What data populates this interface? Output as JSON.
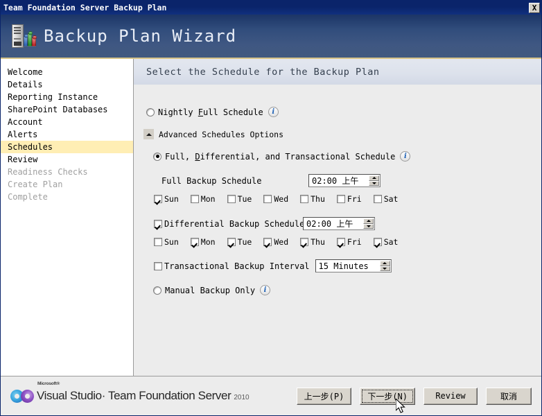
{
  "window": {
    "title": "Team Foundation Server Backup Plan",
    "close_label": "X"
  },
  "banner": {
    "title": "Backup Plan Wizard",
    "icon": "server-backup-icon"
  },
  "sidebar": {
    "items": [
      {
        "label": "Welcome",
        "state": "normal"
      },
      {
        "label": "Details",
        "state": "normal"
      },
      {
        "label": "Reporting Instance",
        "state": "normal"
      },
      {
        "label": "SharePoint Databases",
        "state": "normal"
      },
      {
        "label": "Account",
        "state": "normal"
      },
      {
        "label": "Alerts",
        "state": "normal"
      },
      {
        "label": "Schedules",
        "state": "selected"
      },
      {
        "label": "Review",
        "state": "normal"
      },
      {
        "label": "Readiness Checks",
        "state": "disabled"
      },
      {
        "label": "Create Plan",
        "state": "disabled"
      },
      {
        "label": "Complete",
        "state": "disabled"
      }
    ]
  },
  "content": {
    "heading": "Select the Schedule for the Backup Plan",
    "nightly": {
      "label_pre": "Nightly ",
      "label_accel": "F",
      "label_post": "ull Schedule",
      "checked": false,
      "info": "i"
    },
    "advanced": {
      "label": "Advanced Schedules Options",
      "collapse_icon": "chevron-up-icon"
    },
    "full_diff": {
      "label_pre": "Full, ",
      "label_accel": "D",
      "label_post": "ifferential, and Transactional Schedule",
      "checked": true,
      "info": "i"
    },
    "full_backup": {
      "label": "Full Backup Schedule",
      "time": "02:00 上午",
      "days": [
        {
          "label": "Sun",
          "checked": true
        },
        {
          "label": "Mon",
          "checked": false
        },
        {
          "label": "Tue",
          "checked": false
        },
        {
          "label": "Wed",
          "checked": false
        },
        {
          "label": "Thu",
          "checked": false
        },
        {
          "label": "Fri",
          "checked": false
        },
        {
          "label": "Sat",
          "checked": false
        }
      ]
    },
    "diff_backup": {
      "label": "Differential Backup Schedule",
      "checked": true,
      "time": "02:00 上午",
      "days": [
        {
          "label": "Sun",
          "checked": false
        },
        {
          "label": "Mon",
          "checked": true
        },
        {
          "label": "Tue",
          "checked": true
        },
        {
          "label": "Wed",
          "checked": true
        },
        {
          "label": "Thu",
          "checked": true
        },
        {
          "label": "Fri",
          "checked": true
        },
        {
          "label": "Sat",
          "checked": true
        }
      ]
    },
    "transactional": {
      "label": "Transactional Backup Interval",
      "checked": false,
      "value": "15  Minutes"
    },
    "manual": {
      "label": "Manual Backup Only",
      "checked": false,
      "info": "i"
    }
  },
  "footer": {
    "brand_sup": "Microsoft®",
    "brand_main": "Visual Studio· Team Foundation Server",
    "brand_year": "2010",
    "buttons": [
      {
        "label": "上一步(P)",
        "focused": false
      },
      {
        "label": "下一步(N)",
        "focused": true
      },
      {
        "label": "Review",
        "focused": false
      },
      {
        "label": "取消",
        "focused": false
      }
    ]
  },
  "colors": {
    "titlebar": "#0a246a",
    "banner_top": "#1c3566",
    "banner_bottom": "#41597f",
    "banner_rule": "#d8c488",
    "selected_nav": "#ffeeb4",
    "disabled_text": "#a0a0a0",
    "content_bg": "#ececec"
  }
}
